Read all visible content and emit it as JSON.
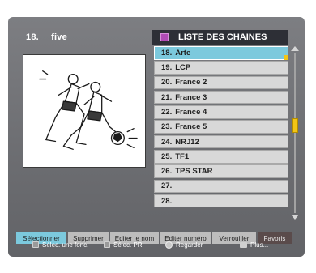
{
  "preview": {
    "channel_number": "18.",
    "channel_name": "five"
  },
  "list": {
    "title": "LISTE DES CHAINES",
    "channels": [
      {
        "number": "18.",
        "name": "Arte"
      },
      {
        "number": "19.",
        "name": "LCP"
      },
      {
        "number": "20.",
        "name": "France 2"
      },
      {
        "number": "21.",
        "name": "France 3"
      },
      {
        "number": "22.",
        "name": "France 4"
      },
      {
        "number": "23.",
        "name": "France 5"
      },
      {
        "number": "24.",
        "name": "NRJ12"
      },
      {
        "number": "25.",
        "name": "TF1"
      },
      {
        "number": "26.",
        "name": "TPS STAR"
      },
      {
        "number": "27.",
        "name": ""
      },
      {
        "number": "28.",
        "name": ""
      }
    ],
    "selected_index": 0
  },
  "scroll": {
    "position_fraction": 0.45
  },
  "function_keys": [
    {
      "label": "Sélectionner",
      "state": "active"
    },
    {
      "label": "Supprimer",
      "state": "normal"
    },
    {
      "label": "Editer le nom",
      "state": "normal"
    },
    {
      "label": "Editer numéro",
      "state": "normal"
    },
    {
      "label": "Verrouiller",
      "state": "normal"
    },
    {
      "label": "Favoris",
      "state": "dark"
    }
  ],
  "hints": [
    {
      "icon": "square-button-icon",
      "label": "Sélec. une fonc."
    },
    {
      "icon": "square-button-icon",
      "label": "Sélec. PR"
    },
    {
      "icon": "ok-button-icon",
      "label": "Regarder"
    },
    {
      "icon": "info-button-icon",
      "label": "Plus..."
    }
  ],
  "colors": {
    "selected": "#7cc9dd",
    "scroll_thumb": "#f3c515",
    "background": "#6e6f73"
  }
}
